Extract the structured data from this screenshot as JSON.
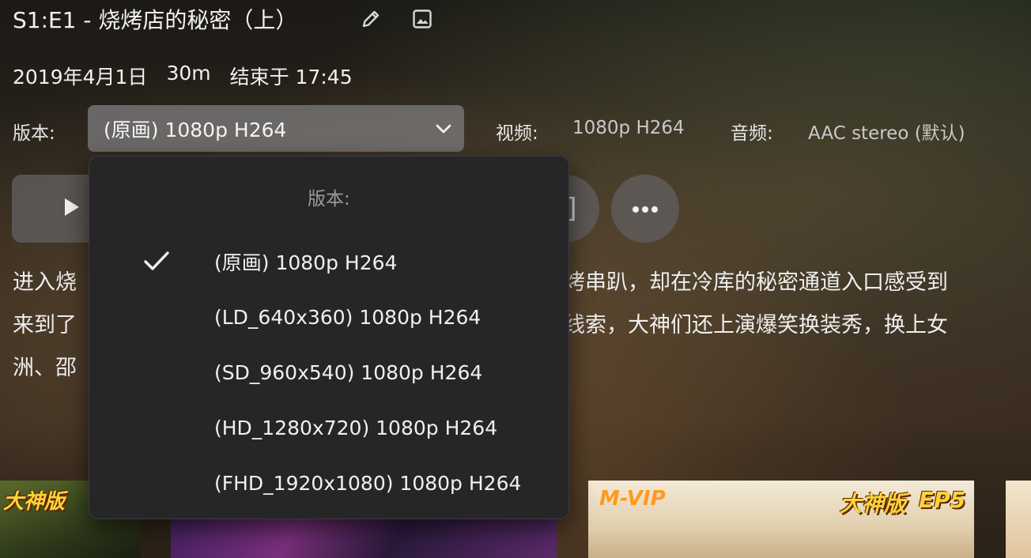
{
  "episode": {
    "title": "S1:E1 - 烧烤店的秘密（上）",
    "date": "2019年4月1日",
    "duration": "30m",
    "ends_at": "结束于 17:45"
  },
  "header_icons": [
    "pencil-edit-icon",
    "image-icon"
  ],
  "version": {
    "label": "版本:",
    "selected": "(原画) 1080p H264"
  },
  "video": {
    "label": "视频:",
    "value": "1080p H264"
  },
  "audio": {
    "label": "音频:",
    "value": "AAC stereo (默认)"
  },
  "overview": {
    "line1_start": "进入烧",
    "line1_end": "烤串趴，却在冷库的秘密通道入口感受到",
    "line2_start": "来到了",
    "line2_end": "线索，大神们还上演爆笑换装秀，换上女",
    "line3_start": "洲、邵",
    "partial_icon_glyph": "]"
  },
  "version_menu": {
    "title": "版本:",
    "items": [
      {
        "label": "(原画) 1080p H264",
        "checked": true
      },
      {
        "label": "(LD_640x360) 1080p H264",
        "checked": false
      },
      {
        "label": "(SD_960x540) 1080p H264",
        "checked": false
      },
      {
        "label": "(HD_1280x720) 1080p H264",
        "checked": false
      },
      {
        "label": "(FHD_1920x1080) 1080p H264",
        "checked": false
      }
    ]
  },
  "thumbnails": {
    "badge_1": "大神版",
    "badge_vip": "M-VIP",
    "badge_2": "大神版",
    "badge_ep": "EP5"
  },
  "colors": {
    "menu_bg": "#262628",
    "select_bg": "#787676",
    "badge_yellow": "#ffd23c"
  }
}
